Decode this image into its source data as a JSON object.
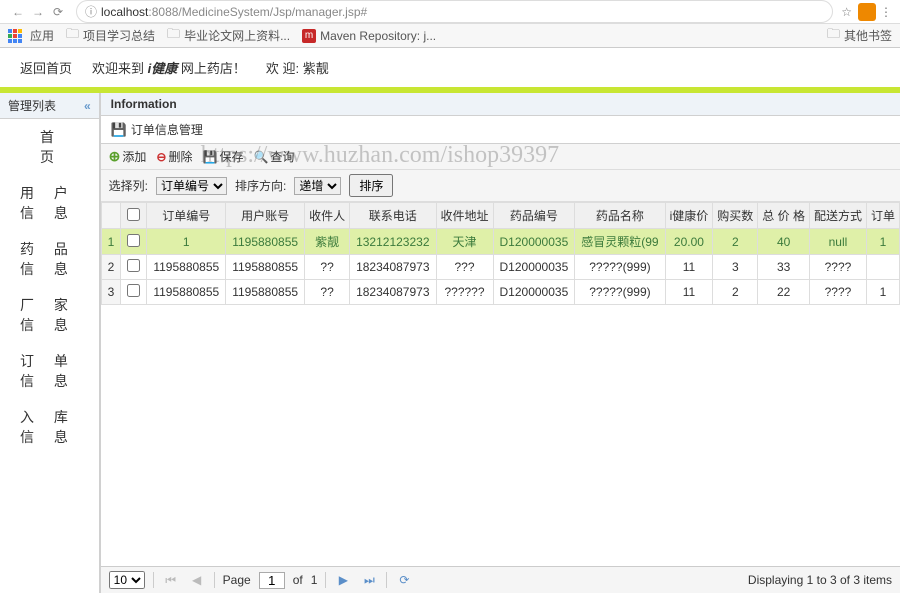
{
  "browser": {
    "url_host": "localhost",
    "url_path": ":8088/MedicineSystem/Jsp/manager.jsp#",
    "bookmarks": {
      "apps": "应用",
      "items": [
        "项目学习总结",
        "毕业论文网上资料...",
        "Maven Repository: j..."
      ],
      "other": "其他书签"
    }
  },
  "header": {
    "back": "返回首页",
    "welcome_prefix": "欢迎来到 ",
    "welcome_brand": "i健康",
    "welcome_suffix": " 网上药店！",
    "greet_prefix": "欢 迎: ",
    "greet_user": "紫靓"
  },
  "sidebar": {
    "title": "管理列表",
    "items": [
      "首 页",
      "用 户 信 息",
      "药 品 信 息",
      "厂 家 信 息",
      "订 单 信 息",
      "入 库 信 息"
    ]
  },
  "content": {
    "title": "Information",
    "subtitle": "订单信息管理"
  },
  "toolbar": {
    "add": "添加",
    "delete": "删除",
    "save": "保存",
    "search": "查询",
    "watermark": "https://www.huzhan.com/ishop39397"
  },
  "filter": {
    "select_col_label": "选择列:",
    "select_col_value": "订单编号",
    "sort_dir_label": "排序方向:",
    "sort_dir_value": "递增",
    "sort_btn": "排序"
  },
  "columns": [
    "订单编号",
    "用户账号",
    "收件人",
    "联系电话",
    "收件地址",
    "药品编号",
    "药品名称",
    "i健康价",
    "购买数",
    "总 价 格",
    "配送方式",
    "订单"
  ],
  "rows": [
    {
      "id": "1",
      "user": "1195880855",
      "receiver": "紫靓",
      "phone": "13212123232",
      "addr": "天津",
      "drugno": "D120000035",
      "drugname": "感冒灵颗粒(99",
      "price": "20.00",
      "qty": "2",
      "total": "40",
      "ship": "null",
      "ord": "1",
      "selected": true
    },
    {
      "id": "1195880855",
      "user": "1195880855",
      "receiver": "??",
      "phone": "18234087973",
      "addr": "???",
      "drugno": "D120000035",
      "drugname": "?????(999)",
      "price": "11",
      "qty": "3",
      "total": "33",
      "ship": "????",
      "ord": "",
      "selected": false
    },
    {
      "id": "1195880855",
      "user": "1195880855",
      "receiver": "??",
      "phone": "18234087973",
      "addr": "??????",
      "drugno": "D120000035",
      "drugname": "?????(999)",
      "price": "11",
      "qty": "2",
      "total": "22",
      "ship": "????",
      "ord": "1",
      "selected": false
    }
  ],
  "pagination": {
    "page_size": "10",
    "page_label": "Page",
    "page_num": "1",
    "of_label": "of",
    "total_pages": "1",
    "display": "Displaying 1 to 3 of 3 items"
  }
}
